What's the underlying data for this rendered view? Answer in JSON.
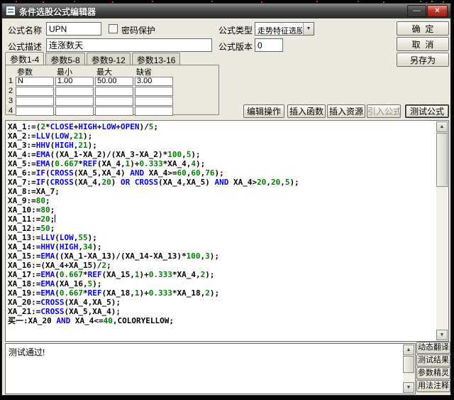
{
  "window": {
    "title": "条件选股公式编辑器"
  },
  "icons": {
    "minimize": "—",
    "close": "×",
    "dropdown_arrow": "▼",
    "scroll_up": "▲",
    "scroll_down": "▼"
  },
  "colors": {
    "close_button": "#c0392b",
    "dialog_background": "#ebe9dd"
  },
  "form": {
    "name_label": "公式名称",
    "name_value": "UPN",
    "password_label": "密码保护",
    "password_checked": false,
    "type_label": "公式类型",
    "type_value": "走势特征选股",
    "desc_label": "公式描述",
    "desc_value": "连涨数天",
    "version_label": "公式版本",
    "version_value": "0"
  },
  "dialog_buttons": {
    "ok": "确  定",
    "cancel": "取  消",
    "save_as": "另存为"
  },
  "tabs": [
    {
      "label": "参数1-4",
      "name": "tab-params-1-4",
      "active": true
    },
    {
      "label": "参数5-8",
      "name": "tab-params-5-8",
      "active": false
    },
    {
      "label": "参数9-12",
      "name": "tab-params-9-12",
      "active": false
    },
    {
      "label": "参数13-16",
      "name": "tab-params-13-16",
      "active": false
    }
  ],
  "param_table": {
    "headers": [
      "参数",
      "最小",
      "最大",
      "缺省"
    ],
    "rows": [
      {
        "index": "1",
        "values": [
          "N",
          "1.00",
          "50.00",
          "3.00"
        ]
      },
      {
        "index": "2",
        "values": [
          "",
          "",
          "",
          ""
        ]
      },
      {
        "index": "3",
        "values": [
          "",
          "",
          "",
          ""
        ]
      },
      {
        "index": "4",
        "values": [
          "",
          "",
          "",
          ""
        ]
      }
    ]
  },
  "action_buttons": [
    {
      "label": "编辑操作",
      "name": "edit-operations-button",
      "disabled": false
    },
    {
      "label": "插入函数",
      "name": "insert-function-button",
      "disabled": false
    },
    {
      "label": "插入资源",
      "name": "insert-resource-button",
      "disabled": false
    },
    {
      "label": "引入公式",
      "name": "import-formula-button",
      "disabled": true
    },
    {
      "label": "测试公式",
      "name": "test-formula-button",
      "disabled": false
    }
  ],
  "editor": {
    "caret_after_line": 10,
    "syntax_colors": {
      "function": "#0000ff",
      "number": "#008000",
      "plain": "#000000"
    },
    "lines": [
      [
        [
          "XA_1:=(",
          "p"
        ],
        [
          "2",
          "n"
        ],
        [
          "*",
          "p"
        ],
        [
          "CLOSE",
          "f"
        ],
        [
          "+",
          "p"
        ],
        [
          "HIGH",
          "f"
        ],
        [
          "+",
          "p"
        ],
        [
          "LOW",
          "f"
        ],
        [
          "+",
          "p"
        ],
        [
          "OPEN",
          "f"
        ],
        [
          ")/",
          "p"
        ],
        [
          "5",
          "n"
        ],
        [
          ";",
          "p"
        ]
      ],
      [
        [
          "XA_2:=",
          "p"
        ],
        [
          "LLV",
          "f"
        ],
        [
          "(",
          "p"
        ],
        [
          "LOW",
          "f"
        ],
        [
          ",",
          "p"
        ],
        [
          "21",
          "n"
        ],
        [
          ");",
          "p"
        ]
      ],
      [
        [
          "XA_3:=",
          "p"
        ],
        [
          "HHV",
          "f"
        ],
        [
          "(",
          "p"
        ],
        [
          "HIGH",
          "f"
        ],
        [
          ",",
          "p"
        ],
        [
          "21",
          "n"
        ],
        [
          ");",
          "p"
        ]
      ],
      [
        [
          "XA_4:=",
          "p"
        ],
        [
          "EMA",
          "f"
        ],
        [
          "((XA_1-XA_2)/(XA_3-XA_2)*",
          "p"
        ],
        [
          "100",
          "n"
        ],
        [
          ",",
          "p"
        ],
        [
          "5",
          "n"
        ],
        [
          ");",
          "p"
        ]
      ],
      [
        [
          "XA_5:=",
          "p"
        ],
        [
          "EMA",
          "f"
        ],
        [
          "(",
          "p"
        ],
        [
          "0.667",
          "n"
        ],
        [
          "*",
          "p"
        ],
        [
          "REF",
          "f"
        ],
        [
          "(XA_4,",
          "p"
        ],
        [
          "1",
          "n"
        ],
        [
          ")+",
          "p"
        ],
        [
          "0.333",
          "n"
        ],
        [
          "*XA_4,",
          "p"
        ],
        [
          "4",
          "n"
        ],
        [
          ");",
          "p"
        ]
      ],
      [
        [
          "XA_6:=",
          "p"
        ],
        [
          "IF",
          "f"
        ],
        [
          "(",
          "p"
        ],
        [
          "CROSS",
          "f"
        ],
        [
          "(XA_5,XA_4) ",
          "p"
        ],
        [
          "AND",
          "f"
        ],
        [
          " XA_4>=",
          "p"
        ],
        [
          "60",
          "n"
        ],
        [
          ",",
          "p"
        ],
        [
          "60",
          "n"
        ],
        [
          ",",
          "p"
        ],
        [
          "76",
          "n"
        ],
        [
          ");",
          "p"
        ]
      ],
      [
        [
          "XA_7:=",
          "p"
        ],
        [
          "IF",
          "f"
        ],
        [
          "(",
          "p"
        ],
        [
          "CROSS",
          "f"
        ],
        [
          "(XA_4,",
          "p"
        ],
        [
          "20",
          "n"
        ],
        [
          ") ",
          "p"
        ],
        [
          "OR",
          "f"
        ],
        [
          " ",
          "p"
        ],
        [
          "CROSS",
          "f"
        ],
        [
          "(XA_4,XA_5) ",
          "p"
        ],
        [
          "AND",
          "f"
        ],
        [
          " XA_4>",
          "p"
        ],
        [
          "20",
          "n"
        ],
        [
          ",",
          "p"
        ],
        [
          "20",
          "n"
        ],
        [
          ",",
          "p"
        ],
        [
          "5",
          "n"
        ],
        [
          ");",
          "p"
        ]
      ],
      [
        [
          "XA_8:=XA_7;",
          "p"
        ]
      ],
      [
        [
          "XA_9:=",
          "p"
        ],
        [
          "80",
          "n"
        ],
        [
          ";",
          "p"
        ]
      ],
      [
        [
          "XA_10:=",
          "p"
        ],
        [
          "80",
          "n"
        ],
        [
          ";",
          "p"
        ]
      ],
      [
        [
          "XA_11:=",
          "p"
        ],
        [
          "20",
          "n"
        ],
        [
          ";",
          "p"
        ]
      ],
      [
        [
          "XA_12:=",
          "p"
        ],
        [
          "50",
          "n"
        ],
        [
          ";",
          "p"
        ]
      ],
      [
        [
          "XA_13:=",
          "p"
        ],
        [
          "LLV",
          "f"
        ],
        [
          "(",
          "p"
        ],
        [
          "LOW",
          "f"
        ],
        [
          ",",
          "p"
        ],
        [
          "55",
          "n"
        ],
        [
          ");",
          "p"
        ]
      ],
      [
        [
          "XA_14:=",
          "p"
        ],
        [
          "HHV",
          "f"
        ],
        [
          "(",
          "p"
        ],
        [
          "HIGH",
          "f"
        ],
        [
          ",",
          "p"
        ],
        [
          "34",
          "n"
        ],
        [
          ");",
          "p"
        ]
      ],
      [
        [
          "XA_15:=",
          "p"
        ],
        [
          "EMA",
          "f"
        ],
        [
          "((XA_1-XA_13)/(XA_14-XA_13)*",
          "p"
        ],
        [
          "100",
          "n"
        ],
        [
          ",",
          "p"
        ],
        [
          "3",
          "n"
        ],
        [
          ");",
          "p"
        ]
      ],
      [
        [
          "XA_16:=(XA_4+XA_15)/",
          "p"
        ],
        [
          "2",
          "n"
        ],
        [
          ";",
          "p"
        ]
      ],
      [
        [
          "XA_17:=",
          "p"
        ],
        [
          "EMA",
          "f"
        ],
        [
          "(",
          "p"
        ],
        [
          "0.667",
          "n"
        ],
        [
          "*",
          "p"
        ],
        [
          "REF",
          "f"
        ],
        [
          "(XA_15,",
          "p"
        ],
        [
          "1",
          "n"
        ],
        [
          ")+",
          "p"
        ],
        [
          "0.333",
          "n"
        ],
        [
          "*XA_4,",
          "p"
        ],
        [
          "2",
          "n"
        ],
        [
          ");",
          "p"
        ]
      ],
      [
        [
          "XA_18:=",
          "p"
        ],
        [
          "EMA",
          "f"
        ],
        [
          "(XA_16,",
          "p"
        ],
        [
          "5",
          "n"
        ],
        [
          ");",
          "p"
        ]
      ],
      [
        [
          "XA_19:=",
          "p"
        ],
        [
          "EMA",
          "f"
        ],
        [
          "(",
          "p"
        ],
        [
          "0.667",
          "n"
        ],
        [
          "*",
          "p"
        ],
        [
          "REF",
          "f"
        ],
        [
          "(XA_18,",
          "p"
        ],
        [
          "1",
          "n"
        ],
        [
          ")+",
          "p"
        ],
        [
          "0.333",
          "n"
        ],
        [
          "*XA_18,",
          "p"
        ],
        [
          "2",
          "n"
        ],
        [
          ");",
          "p"
        ]
      ],
      [
        [
          "XA_20:=",
          "p"
        ],
        [
          "CROSS",
          "f"
        ],
        [
          "(XA_4,XA_5);",
          "p"
        ]
      ],
      [
        [
          "XA_21:=",
          "p"
        ],
        [
          "CROSS",
          "f"
        ],
        [
          "(XA_5,XA_4);",
          "p"
        ]
      ],
      [
        [
          "买一:XA_20 ",
          "p"
        ],
        [
          "AND",
          "f"
        ],
        [
          " XA_4<=",
          "p"
        ],
        [
          "40",
          "n"
        ],
        [
          ",COLORYELLOW;",
          "p"
        ]
      ]
    ]
  },
  "output": {
    "message": "测试通过!"
  },
  "side_buttons": [
    {
      "label": "动态翻译",
      "name": "dynamic-translate-button"
    },
    {
      "label": "测试结果",
      "name": "test-result-button"
    },
    {
      "label": "参数精灵",
      "name": "param-wizard-button"
    },
    {
      "label": "用法注释",
      "name": "usage-notes-button"
    }
  ]
}
